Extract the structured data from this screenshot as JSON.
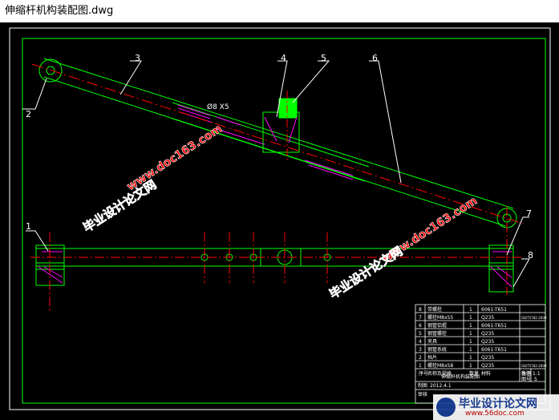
{
  "window": {
    "title": "伸缩杆机构装配图.dwg"
  },
  "colors": {
    "background": "#000000",
    "outline": "#00ff00",
    "centerline": "#ff0000",
    "callout": "#ffffff",
    "hatch": "#ff00ff",
    "nut": "#00ff00",
    "watermark": "#ff0000"
  },
  "callouts": [
    "1",
    "2",
    "3",
    "4",
    "5",
    "6",
    "7",
    "8"
  ],
  "dimension": {
    "text": "Ø8 X5"
  },
  "watermarks": {
    "site": "www.doc163.com",
    "site_cn": "毕业设计论文网"
  },
  "title_block": {
    "rows": [
      {
        "no": "8",
        "name": "带螺栓",
        "qty": "1",
        "material": "6061-T651",
        "note": ""
      },
      {
        "no": "7",
        "name": "螺栓M8x55",
        "qty": "1",
        "material": "Q235",
        "note": "GB/T5782-2000"
      },
      {
        "no": "6",
        "name": "钢管铝棍",
        "qty": "1",
        "material": "6061-T651",
        "note": ""
      },
      {
        "no": "5",
        "name": "钢管螺栓",
        "qty": "1",
        "material": "Q235",
        "note": ""
      },
      {
        "no": "4",
        "name": "夹具",
        "qty": "1",
        "material": "Q235",
        "note": ""
      },
      {
        "no": "3",
        "name": "钢管系统",
        "qty": "1",
        "material": "6061-T651",
        "note": ""
      },
      {
        "no": "2",
        "name": "挡片",
        "qty": "1",
        "material": "Q235",
        "note": ""
      },
      {
        "no": "1",
        "name": "螺栓M8x58",
        "qty": "1",
        "material": "Q235",
        "note": "GB/T5782-2000"
      }
    ],
    "header": {
      "no": "序号",
      "name": "名称及规格",
      "qty": "数量",
      "material": "材料",
      "note": "备注"
    },
    "drawing_name": "伸缩杆机构装配图",
    "scale_label": "比例",
    "scale_value": "1:1",
    "sheet_label": "图号",
    "sheet_value": "5",
    "date": "2012.4.1",
    "designer_label": "制图",
    "checker_label": "审核"
  },
  "footer_logo": {
    "text_cn": "毕业设计论文网",
    "url": "www.56doc.com"
  }
}
